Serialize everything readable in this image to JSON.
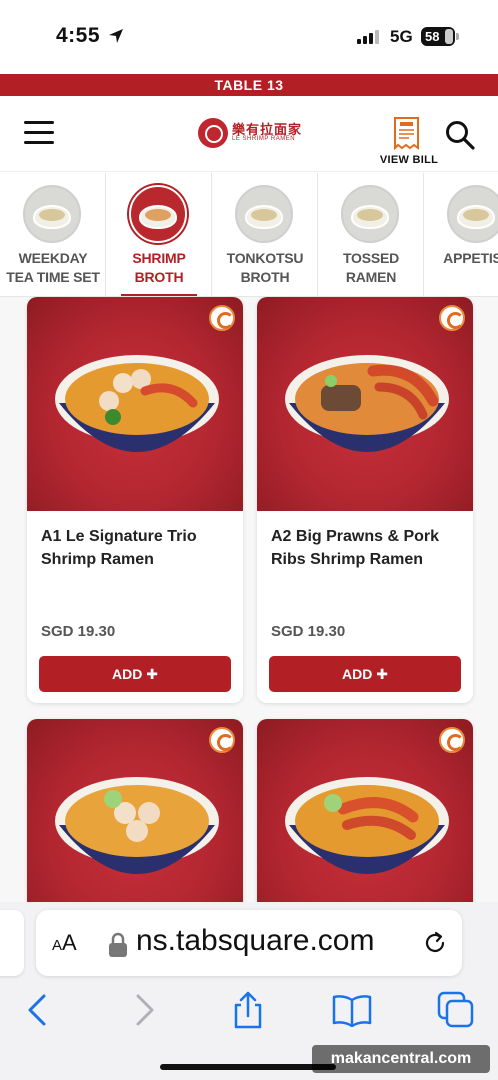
{
  "status_bar": {
    "time": "4:55",
    "network": "5G",
    "battery": "58"
  },
  "table_banner": "TABLE 13",
  "header": {
    "logo_chinese": "樂有拉面家",
    "logo_english": "LE SHRIMP RAMEN",
    "bill_label": "VIEW BILL"
  },
  "categories": [
    {
      "label_1": "WEEKDAY",
      "label_2": "TEA TIME SET",
      "active": false
    },
    {
      "label_1": "SHRIMP",
      "label_2": "BROTH",
      "active": true
    },
    {
      "label_1": "TONKOTSU",
      "label_2": "BROTH",
      "active": false
    },
    {
      "label_1": "TOSSED",
      "label_2": "RAMEN",
      "active": false
    },
    {
      "label_1": "APPETISE",
      "label_2": "",
      "active": false
    }
  ],
  "menu_items": [
    {
      "name": "A1 Le Signature Trio Shrimp Ramen",
      "price": "SGD 19.30",
      "add_label": "ADD"
    },
    {
      "name": "A2 Big Prawns & Pork Ribs Shrimp Ramen",
      "price": "SGD 19.30",
      "add_label": "ADD"
    },
    {
      "name": "",
      "price": "",
      "add_label": ""
    },
    {
      "name": "",
      "price": "",
      "add_label": ""
    }
  ],
  "browser": {
    "aa_label": "AA",
    "url": "ns.tabsquare.com"
  },
  "watermark": "makancentral.com",
  "colors": {
    "brand_red": "#b21f24",
    "accent_orange": "#e36b1d"
  },
  "icons": [
    "location-arrow-icon",
    "signal-icon",
    "battery-icon",
    "hamburger-menu-icon",
    "bill-icon",
    "search-icon",
    "shrimp-icon",
    "plus-icon",
    "lock-icon",
    "reload-icon",
    "back-icon",
    "forward-icon",
    "share-icon",
    "bookmarks-icon",
    "tabs-icon"
  ]
}
